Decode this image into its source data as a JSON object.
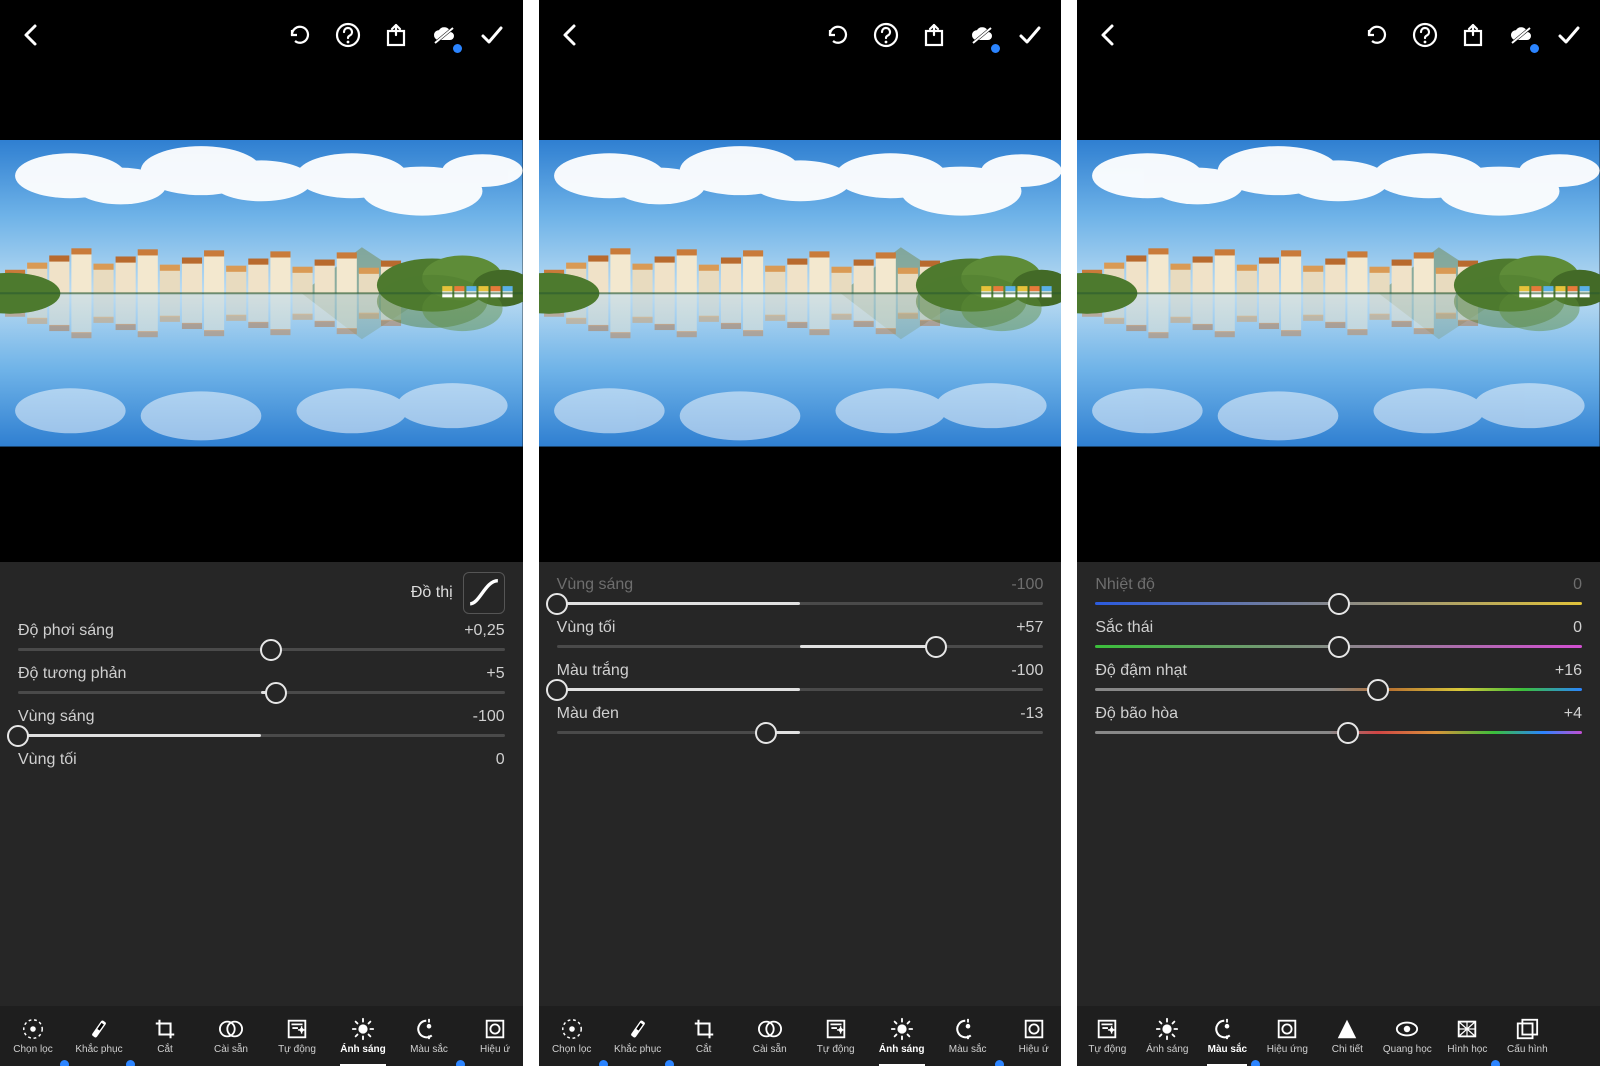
{
  "screens": [
    {
      "id": "light-panel-1",
      "top_icons": [
        "back",
        "undo",
        "help",
        "share",
        "cloud",
        "confirm"
      ],
      "graph_button": "Đồ thị",
      "sliders": [
        {
          "label": "Độ phơi sáng",
          "value_text": "+0,25",
          "pos": 52,
          "fill_from": 50,
          "fill_to": 52
        },
        {
          "label": "Độ tương phản",
          "value_text": "+5",
          "pos": 53,
          "fill_from": 50,
          "fill_to": 53
        },
        {
          "label": "Vùng sáng",
          "value_text": "-100",
          "pos": 0,
          "fill_from": 0,
          "fill_to": 50
        },
        {
          "label": "Vùng tối",
          "value_text": "0",
          "pos": null
        }
      ],
      "tabs_a": [
        "Chọn lọc",
        "Khắc phục",
        "Cắt",
        "Cài sẵn"
      ],
      "tabs_b": [
        "Tự động",
        "Ánh sáng",
        "Màu sắc",
        "Hiệu ứ"
      ],
      "active_tab": "Ánh sáng"
    },
    {
      "id": "light-panel-2",
      "top_icons": [
        "back",
        "undo",
        "help",
        "share",
        "cloud",
        "confirm"
      ],
      "sliders": [
        {
          "label": "Vùng sáng",
          "value_text": "-100",
          "pos": 0,
          "fill_from": 0,
          "fill_to": 50,
          "cut": true
        },
        {
          "label": "Vùng tối",
          "value_text": "+57",
          "pos": 78,
          "fill_from": 50,
          "fill_to": 78
        },
        {
          "label": "Màu trắng",
          "value_text": "-100",
          "pos": 0,
          "fill_from": 0,
          "fill_to": 50
        },
        {
          "label": "Màu đen",
          "value_text": "-13",
          "pos": 43,
          "fill_from": 43,
          "fill_to": 50
        }
      ],
      "tabs_a": [
        "Chọn lọc",
        "Khắc phục",
        "Cắt",
        "Cài sẵn"
      ],
      "tabs_b": [
        "Tự động",
        "Ánh sáng",
        "Màu sắc",
        "Hiệu ứ"
      ],
      "active_tab": "Ánh sáng"
    },
    {
      "id": "color-panel",
      "top_icons": [
        "back",
        "undo",
        "help",
        "share",
        "cloud",
        "confirm"
      ],
      "sliders": [
        {
          "label": "Nhiệt độ",
          "value_text": "0",
          "pos": 50,
          "grad": "grad-temp",
          "cut": true
        },
        {
          "label": "Sắc thái",
          "value_text": "0",
          "pos": 50,
          "grad": "grad-tint"
        },
        {
          "label": "Độ đậm nhạt",
          "value_text": "+16",
          "pos": 58,
          "grad": "grad-vib"
        },
        {
          "label": "Độ bão hòa",
          "value_text": "+4",
          "pos": 52,
          "grad": "grad-sat"
        }
      ],
      "tabs_full": [
        "Tự động",
        "Ánh sáng",
        "Màu sắc",
        "Hiệu ứng",
        "Chi tiết",
        "Quang học",
        "Hình học",
        "Cấu hình"
      ],
      "active_tab": "Màu sắc"
    }
  ],
  "icon_names": {
    "back": "chevron-left-icon",
    "undo": "undo-icon",
    "help": "help-circle-icon",
    "share": "share-icon",
    "cloud": "cloud-sync-icon",
    "confirm": "check-icon",
    "curve": "curve-icon"
  },
  "tab_icons_a": [
    "selective",
    "heal",
    "crop",
    "presets"
  ],
  "tab_icons_b": [
    "auto",
    "light",
    "color",
    "effects"
  ],
  "tab_icons_full": [
    "auto",
    "light",
    "color",
    "effects",
    "detail",
    "optics",
    "geometry",
    "profiles"
  ]
}
